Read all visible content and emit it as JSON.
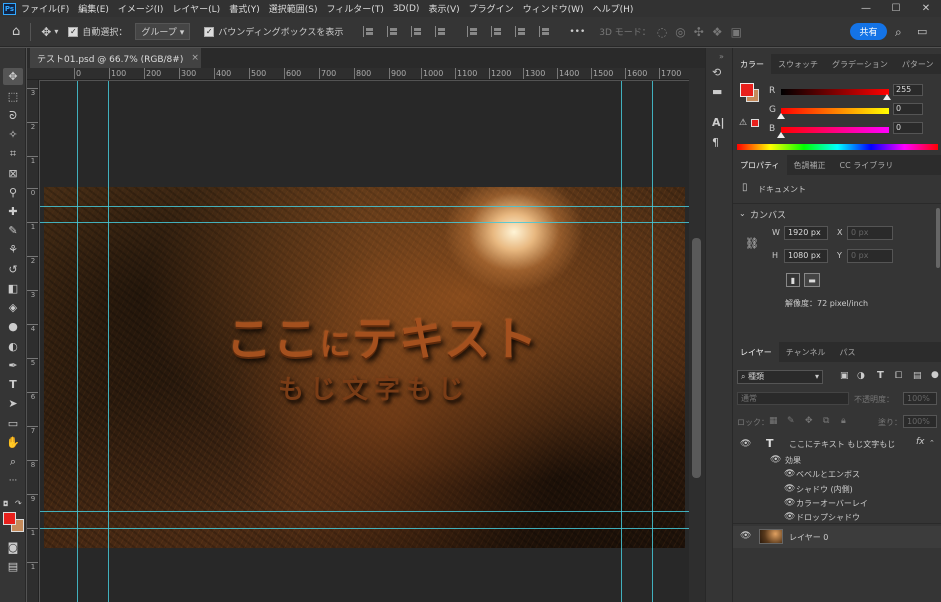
{
  "app": {
    "logo": "Ps"
  },
  "menu": [
    "ファイル(F)",
    "編集(E)",
    "イメージ(I)",
    "レイヤー(L)",
    "書式(Y)",
    "選択範囲(S)",
    "フィルター(T)",
    "3D(D)",
    "表示(V)",
    "プラグイン",
    "ウィンドウ(W)",
    "ヘルプ(H)"
  ],
  "window_controls": {
    "minimize": "—",
    "maximize": "☐",
    "close": "✕"
  },
  "options": {
    "auto_select_label": "自動選択：",
    "auto_select_value": "グループ",
    "bbox_label": "バウンディングボックスを表示",
    "more": "•••",
    "mode3d": "3D モード：",
    "share": "共有"
  },
  "document": {
    "tab_title": "テスト01.psd @ 66.7% (RGB/8#)",
    "tab_close": "×"
  },
  "ruler": {
    "top": [
      "0",
      "100",
      "200",
      "300",
      "400",
      "500",
      "600",
      "700",
      "800",
      "900",
      "1000",
      "1100",
      "1200",
      "1300",
      "1400",
      "1500",
      "1600",
      "1700",
      "1800",
      "190"
    ],
    "left": [
      "3",
      "2",
      "1",
      "0",
      "1",
      "2",
      "3",
      "4",
      "5",
      "6",
      "7",
      "8",
      "9",
      "1",
      "1"
    ]
  },
  "canvas": {
    "text_main_a": "ここ",
    "text_main_b": "に",
    "text_main_c": "テキスト",
    "text_sub": "もじ文字もじ"
  },
  "color_panel": {
    "tabs": [
      "カラー",
      "スウォッチ",
      "グラデーション",
      "パターン"
    ],
    "channels": [
      {
        "name": "R",
        "value": "255"
      },
      {
        "name": "G",
        "value": "0"
      },
      {
        "name": "B",
        "value": "0"
      }
    ],
    "foreground": "#e8201c",
    "background": "#c48a5a"
  },
  "properties_panel": {
    "tabs": [
      "プロパティ",
      "色調補正",
      "CC ライブラリ"
    ],
    "doc_label": "ドキュメント",
    "canvas_label": "カンバス",
    "w_label": "W",
    "w_value": "1920 px",
    "h_label": "H",
    "h_value": "1080 px",
    "x_label": "X",
    "x_value": "0 px",
    "y_label": "Y",
    "y_value": "0 px",
    "resolution": "解像度：72 pixel/inch"
  },
  "layers_panel": {
    "tabs": [
      "レイヤー",
      "チャンネル",
      "パス"
    ],
    "filter_label": "種類",
    "blend_mode": "通常",
    "opacity_label": "不透明度：",
    "opacity_value": "100%",
    "lock_label": "ロック：",
    "fill_label": "塗り：",
    "fill_value": "100%",
    "layers": [
      {
        "name": "ここにテキスト もじ文字もじ",
        "fx": "fx"
      },
      {
        "name": "レイヤー 0"
      }
    ],
    "effects_label": "効果",
    "effects": [
      "ベベルとエンボス",
      "シャドウ (内側)",
      "カラーオーバーレイ",
      "ドロップシャドウ"
    ]
  }
}
